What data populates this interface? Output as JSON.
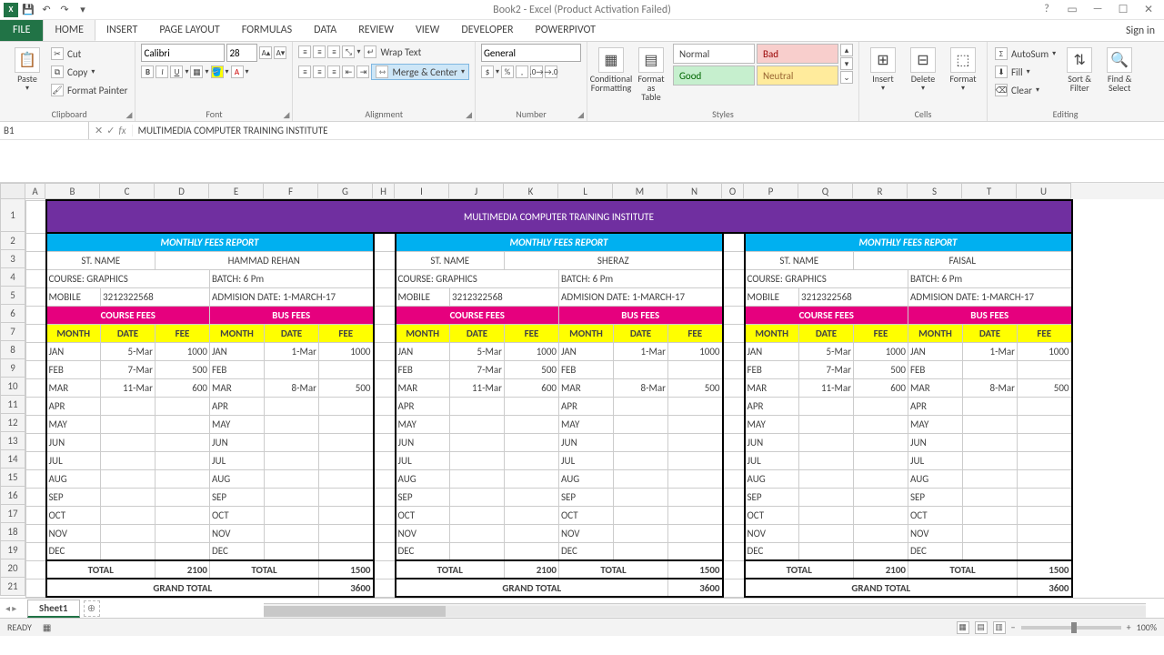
{
  "titlebar": {
    "title": "Book2 - Excel (Product Activation Failed)"
  },
  "tabs": {
    "file": "FILE",
    "list": [
      "HOME",
      "INSERT",
      "PAGE LAYOUT",
      "FORMULAS",
      "DATA",
      "REVIEW",
      "VIEW",
      "DEVELOPER",
      "POWERPIVOT"
    ],
    "active": "HOME",
    "signin": "Sign in"
  },
  "ribbon": {
    "clipboard": {
      "paste": "Paste",
      "cut": "Cut",
      "copy": "Copy",
      "fp": "Format Painter",
      "label": "Clipboard"
    },
    "font": {
      "name": "Calibri",
      "size": "28",
      "label": "Font"
    },
    "alignment": {
      "wrap": "Wrap Text",
      "merge": "Merge & Center",
      "label": "Alignment"
    },
    "number": {
      "fmt": "General",
      "label": "Number"
    },
    "styles": {
      "cf": "Conditional\nFormatting",
      "ft": "Format as\nTable",
      "normal": "Normal",
      "bad": "Bad",
      "good": "Good",
      "neutral": "Neutral",
      "label": "Styles"
    },
    "cells": {
      "insert": "Insert",
      "delete": "Delete",
      "format": "Format",
      "label": "Cells"
    },
    "editing": {
      "sum": "AutoSum",
      "fill": "Fill",
      "clear": "Clear",
      "sort": "Sort &\nFilter",
      "find": "Find &\nSelect",
      "label": "Editing"
    }
  },
  "formula_bar": {
    "namebox": "B1",
    "value": "MULTIMEDIA COMPUTER TRAINING INSTITUTE"
  },
  "sheet": {
    "col_letters": [
      "A",
      "B",
      "C",
      "D",
      "E",
      "F",
      "G",
      "H",
      "I",
      "J",
      "K",
      "L",
      "M",
      "N",
      "O",
      "P",
      "Q",
      "R",
      "S",
      "T",
      "U"
    ],
    "col_w": {
      "A": 22,
      "B": 60,
      "C": 60,
      "D": 60,
      "E": 60,
      "F": 60,
      "G": 60,
      "H": 24,
      "I": 60,
      "J": 60,
      "K": 60,
      "L": 60,
      "M": 60,
      "N": 60,
      "O": 24,
      "P": 60,
      "Q": 60,
      "R": 60,
      "S": 60,
      "T": 60,
      "U": 60
    },
    "row_heights": {
      "1": 36
    },
    "row_count": 21,
    "title": "MULTIMEDIA COMPUTER TRAINING INSTITUTE",
    "labels": {
      "monthly": "MONTHLY FEES REPORT",
      "stname": "ST. NAME",
      "course": "COURSE: GRAPHICS",
      "batch": "BATCH: 6 Pm",
      "mobile": "MOBILE",
      "mobile_val": "3212322568",
      "adm": "ADMISION DATE: 1-MARCH-17",
      "cfees": "COURSE FEES",
      "bfees": "BUS FEES",
      "month": "MONTH",
      "date": "DATE",
      "fee": "FEE",
      "total": "TOTAL",
      "grand": "GRAND TOTAL"
    },
    "students": [
      "HAMMAD REHAN",
      "SHERAZ",
      "FAISAL"
    ],
    "months": [
      "JAN",
      "FEB",
      "MAR",
      "APR",
      "MAY",
      "JUN",
      "JUL",
      "AUG",
      "SEP",
      "OCT",
      "NOV",
      "DEC"
    ],
    "course_data": [
      {
        "date": "5-Mar",
        "fee": "1000"
      },
      {
        "date": "7-Mar",
        "fee": "500"
      },
      {
        "date": "11-Mar",
        "fee": "600"
      }
    ],
    "bus_data": [
      {
        "date": "1-Mar",
        "fee": "1000"
      },
      {
        "date": "",
        "fee": ""
      },
      {
        "date": "8-Mar",
        "fee": "500"
      }
    ],
    "totals": {
      "course": "2100",
      "bus": "1500",
      "grand": "3600"
    }
  },
  "bottom": {
    "ready": "READY",
    "sheet": "Sheet1",
    "zoom": "100%"
  }
}
